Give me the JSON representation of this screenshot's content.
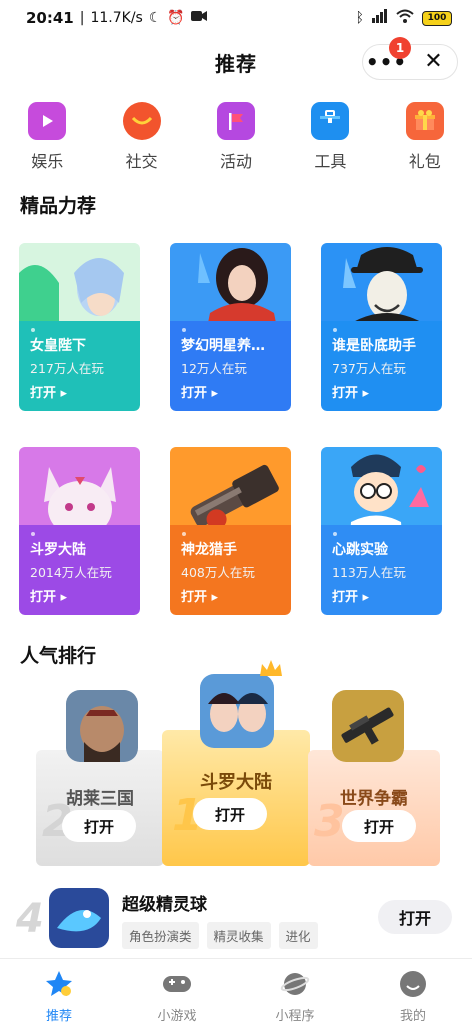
{
  "status_bar": {
    "time": "20:41",
    "speed": "11.7K/s",
    "battery": "100"
  },
  "header": {
    "title": "推荐",
    "badge_count": "1",
    "more_label": "•••",
    "close_label": "✕"
  },
  "categories": [
    {
      "label": "娱乐",
      "icon": "entertainment-icon",
      "color": "#c64bdc"
    },
    {
      "label": "社交",
      "icon": "social-icon",
      "color": "#f2542d"
    },
    {
      "label": "活动",
      "icon": "activity-flag-icon",
      "color": "#b548e0"
    },
    {
      "label": "工具",
      "icon": "toolbox-icon",
      "color": "#1e8ff0"
    },
    {
      "label": "礼包",
      "icon": "gift-icon",
      "color": "#f6663b"
    }
  ],
  "featured": {
    "title": "精品力荐",
    "cards": [
      {
        "name": "女皇陛下",
        "players": "217万人在玩",
        "open": "打开",
        "color": "#1fc0b8"
      },
      {
        "name": "梦幻明星养…",
        "players": "12万人在玩",
        "open": "打开",
        "color": "#2f7bf4"
      },
      {
        "name": "谁是卧底助手",
        "players": "737万人在玩",
        "open": "打开",
        "color": "#1f8ff2"
      },
      {
        "name": "斗罗大陆",
        "players": "2014万人在玩",
        "open": "打开",
        "color": "#9c4ae6"
      },
      {
        "name": "神龙猎手",
        "players": "408万人在玩",
        "open": "打开",
        "color": "#f4761f"
      },
      {
        "name": "心跳实验",
        "players": "113万人在玩",
        "open": "打开",
        "color": "#2f8df4"
      }
    ]
  },
  "ranking": {
    "title": "人气排行",
    "podium": [
      {
        "rank": "2",
        "name": "胡莱三国",
        "open": "打开"
      },
      {
        "rank": "1",
        "name": "斗罗大陆",
        "open": "打开"
      },
      {
        "rank": "3",
        "name": "世界争霸",
        "open": "打开"
      }
    ],
    "list": [
      {
        "rank": "4",
        "name": "超级精灵球",
        "tags": [
          "角色扮演类",
          "精灵收集",
          "进化"
        ],
        "open": "打开"
      }
    ]
  },
  "tabs": [
    {
      "label": "推荐",
      "icon": "star-icon",
      "active": true
    },
    {
      "label": "小游戏",
      "icon": "gamepad-icon",
      "active": false
    },
    {
      "label": "小程序",
      "icon": "planet-icon",
      "active": false
    },
    {
      "label": "我的",
      "icon": "profile-icon",
      "active": false
    }
  ]
}
